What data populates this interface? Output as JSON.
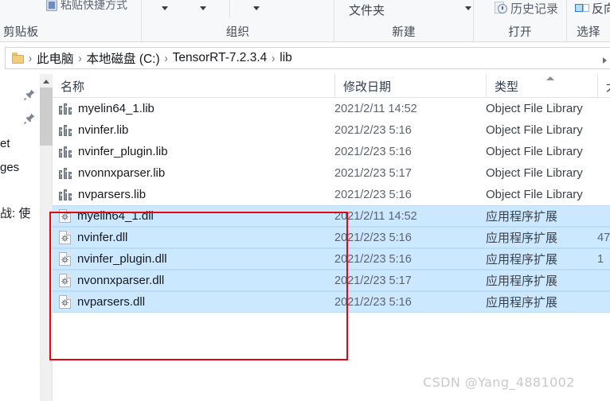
{
  "ribbon": {
    "groups": [
      {
        "title": "剪贴板"
      },
      {
        "title": "组织"
      },
      {
        "title": "新建"
      },
      {
        "title": "打开"
      },
      {
        "title": "选择"
      }
    ],
    "paste_shortcut_label": "粘贴快捷方式",
    "new_folder_label": "文件夹",
    "history_label": "历史记录",
    "invert_selection_label": "反向"
  },
  "address": {
    "crumbs": [
      "此电脑",
      "本地磁盘 (C:)",
      "TensorRT-7.2.3.4",
      "lib"
    ],
    "separator": "›"
  },
  "navpane": {
    "items": [
      {
        "label": "et"
      },
      {
        "label": "ges"
      },
      {
        "label": "战: 使"
      }
    ]
  },
  "columns": [
    {
      "label": "名称",
      "key": "name"
    },
    {
      "label": "修改日期",
      "key": "date"
    },
    {
      "label": "类型",
      "key": "type"
    },
    {
      "label": "大",
      "key": "size"
    }
  ],
  "sorted_column": "类型",
  "files": [
    {
      "name": "myelin64_1.lib",
      "date": "2021/2/11 14:52",
      "type": "Object File Library",
      "size": "",
      "icon": "lib-icon",
      "selected": false
    },
    {
      "name": "nvinfer.lib",
      "date": "2021/2/23 5:16",
      "type": "Object File Library",
      "size": "",
      "icon": "lib-icon",
      "selected": false
    },
    {
      "name": "nvinfer_plugin.lib",
      "date": "2021/2/23 5:16",
      "type": "Object File Library",
      "size": "",
      "icon": "lib-icon",
      "selected": false
    },
    {
      "name": "nvonnxparser.lib",
      "date": "2021/2/23 5:17",
      "type": "Object File Library",
      "size": "",
      "icon": "lib-icon",
      "selected": false
    },
    {
      "name": "nvparsers.lib",
      "date": "2021/2/23 5:16",
      "type": "Object File Library",
      "size": "",
      "icon": "lib-icon",
      "selected": false
    },
    {
      "name": "myelin64_1.dll",
      "date": "2021/2/11 14:52",
      "type": "应用程序扩展",
      "size": "",
      "icon": "dll-icon",
      "selected": true
    },
    {
      "name": "nvinfer.dll",
      "date": "2021/2/23 5:16",
      "type": "应用程序扩展",
      "size": "47",
      "icon": "dll-icon",
      "selected": true
    },
    {
      "name": "nvinfer_plugin.dll",
      "date": "2021/2/23 5:16",
      "type": "应用程序扩展",
      "size": "1",
      "icon": "dll-icon",
      "selected": true
    },
    {
      "name": "nvonnxparser.dll",
      "date": "2021/2/23 5:17",
      "type": "应用程序扩展",
      "size": "",
      "icon": "dll-icon",
      "selected": true
    },
    {
      "name": "nvparsers.dll",
      "date": "2021/2/23 5:16",
      "type": "应用程序扩展",
      "size": "",
      "icon": "dll-icon",
      "selected": true
    }
  ],
  "annotation": {
    "color": "#e30613"
  },
  "watermark": {
    "text": "CSDN @Yang_4881002",
    "color": "#c9c9c9"
  }
}
